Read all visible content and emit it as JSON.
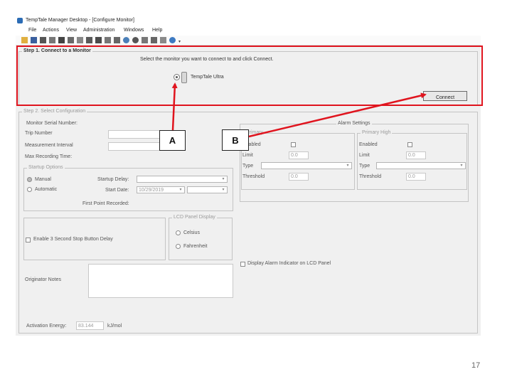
{
  "window": {
    "title": "TempTale Manager Desktop - [Configure Monitor]"
  },
  "menu": [
    "File",
    "Actions",
    "View",
    "Administration",
    "Windows",
    "Help"
  ],
  "step1": {
    "title": "Step 1. Connect to a Monitor",
    "instruction": "Select the monitor you want to connect to and click Connect.",
    "monitor_option": "TempTale Ultra",
    "connect_label": "Connect"
  },
  "step2": {
    "title": "Step 2. Select Configuration",
    "monitor_serial_label": "Monitor Serial Number:",
    "trip_number_label": "Trip Number",
    "measurement_interval_label": "Measurement Interval",
    "max_recording_label": "Max Recording Time:",
    "startup": {
      "title": "Startup Options",
      "manual_label": "Manual",
      "automatic_label": "Automatic",
      "startup_delay_label": "Startup Delay:",
      "start_date_label": "Start Date:",
      "start_date_value": "10/29/2019",
      "first_point_label": "First Point Recorded:"
    },
    "stop_button_label": "Enable 3 Second Stop Button Delay",
    "lcd": {
      "title": "LCD Panel Display",
      "celsius_label": "Celsius",
      "fahrenheit_label": "Fahrenheit"
    },
    "originator_notes_label": "Originator Notes",
    "activation_energy_label": "Activation Energy:",
    "activation_energy_value": "83.144",
    "activation_energy_unit": "kJ/mol",
    "alarm": {
      "title": "Alarm Settings",
      "primary_low": {
        "title": "Primary",
        "enabled_label": "Enabled",
        "limit_label": "Limit",
        "limit_value": "0.0",
        "type_label": "Type",
        "threshold_label": "Threshold",
        "threshold_value": "0.0"
      },
      "primary_high": {
        "title": "Primary High",
        "enabled_label": "Enabled",
        "limit_label": "Limit",
        "limit_value": "0.0",
        "type_label": "Type",
        "threshold_label": "Threshold",
        "threshold_value": "0.0"
      },
      "display_indicator_label": "Display Alarm Indicator on LCD Panel"
    }
  },
  "annotations": {
    "a_label": "A",
    "b_label": "B",
    "accent_color": "#e0141e"
  },
  "slide": {
    "page_number": "17"
  }
}
